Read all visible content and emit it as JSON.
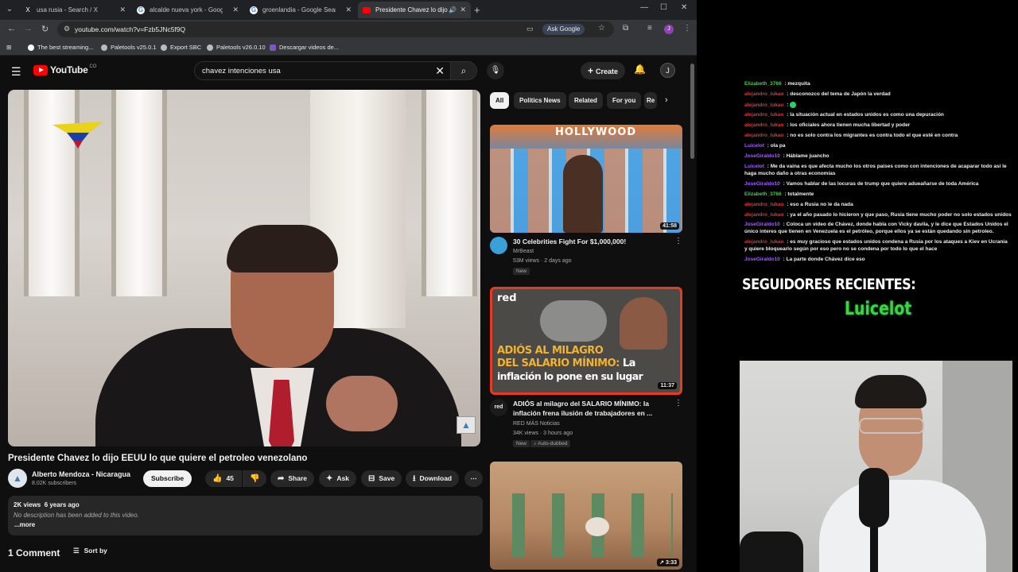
{
  "browser": {
    "tabs": [
      {
        "label": "usa rusia - Search / X",
        "favicon": "x-icon",
        "active": false
      },
      {
        "label": "alcalde nueva york - Google Search",
        "favicon": "google-icon",
        "active": false
      },
      {
        "label": "groenlandia - Google Search",
        "favicon": "google-icon",
        "active": false
      },
      {
        "label": "Presidente Chavez lo dijo EEUU",
        "favicon": "youtube-icon",
        "active": true
      }
    ],
    "url": "youtube.com/watch?v=Fzb5JNc5f9Q",
    "ask_google": "Ask Google",
    "profile_initial": "J",
    "bookmarks": [
      {
        "label": "The best streaming...",
        "color": "#ffffff"
      },
      {
        "label": "Paletools v25.0.1",
        "color": "#bbbbbb"
      },
      {
        "label": "Export SBC",
        "color": "#bbbbbb"
      },
      {
        "label": "Paletools v26.0.10",
        "color": "#bbbbbb"
      },
      {
        "label": "Descargar videos de...",
        "color": "#7e57c2"
      }
    ]
  },
  "youtube": {
    "logo": "YouTube",
    "logo_suffix": "CO",
    "search_query": "chavez intenciones usa",
    "create_label": "Create",
    "avatar_initial": "J",
    "video": {
      "title": "Presidente Chavez lo dijo EEUU lo que quiere el petroleo venezolano",
      "channel": "Alberto Mendoza - Nicaragua",
      "subscribers": "8.02K subscribers",
      "subscribe_label": "Subscribe",
      "likes": "45",
      "share_label": "Share",
      "ask_label": "Ask",
      "save_label": "Save",
      "download_label": "Download",
      "views_age": "2K views  6 years ago",
      "description": "No description has been added to this video.",
      "more_label": "...more",
      "comments_count": "1 Comment",
      "sort_label": "Sort by"
    },
    "chips": [
      "All",
      "Politics News",
      "Related",
      "For you",
      "Re"
    ],
    "recommendations": [
      {
        "title": "30 Celebrities Fight For $1,000,000!",
        "channel": "MrBeast",
        "meta": "53M views · 2 days ago",
        "badge": "New",
        "duration": "41:58",
        "thumb_text": "HOLLYWOOD"
      },
      {
        "title": "ADIÓS al milagro del SALARIO MÍNIMO: la inflación frena ilusión de trabajadores en ...",
        "channel": "RED MÁS Noticias",
        "meta": "34K views · 3 hours ago",
        "badge": "New",
        "badge2": "Auto-dubbed",
        "duration": "11:37",
        "thumb_brand": "red",
        "thumb_line1": "ADIÓS AL MILAGRO",
        "thumb_line2": "DEL SALARIO MÍNIMO:",
        "thumb_line2_accent": "La",
        "thumb_line3": "inflación lo pone en su lugar"
      },
      {
        "duration": "3:33"
      }
    ]
  },
  "stream": {
    "chat": [
      {
        "user": "Elizabeth_3766",
        "color": "#3fd43f",
        "msg": "mezquita"
      },
      {
        "user": "alejandro_lukao",
        "color": "#d23a3a",
        "msg": "desconozco del tema de Japón la verdad"
      },
      {
        "user": "alejandro_lukao",
        "color": "#d23a3a",
        "msg": ""
      },
      {
        "user": "alejandro_lukao",
        "color": "#d23a3a",
        "msg": "la situación actual en estados unidos es como una depuración"
      },
      {
        "user": "alejandro_lukao",
        "color": "#d23a3a",
        "msg": "los oficiales ahora tienen mucha libertad y poder"
      },
      {
        "user": "alejandro_lukao",
        "color": "#d23a3a",
        "msg": "no es solo contra los migrantes es contra todo el que esté en contra"
      },
      {
        "user": "Luicelot",
        "color": "#a55cff",
        "msg": "ola pa"
      },
      {
        "user": "JoseGiraldo10",
        "color": "#a55cff",
        "msg": "Háblame juancho"
      },
      {
        "user": "Luicelot",
        "color": "#a55cff",
        "msg": "Me da vaina es que afecta mucho los otros paises como con intenciones de acaparar todo así le haga mucho daño a otras economías"
      },
      {
        "user": "JoseGiraldo10",
        "color": "#a55cff",
        "msg": "Vamos hablar de las locuras de trump que quiere adueañarse de toda América"
      },
      {
        "user": "Elizabeth_3766",
        "color": "#3fd43f",
        "msg": "totalmente"
      },
      {
        "user": "alejandro_lukao",
        "color": "#d23a3a",
        "msg": "eso a Rusia no le da nada"
      },
      {
        "user": "alejandro_lukao",
        "color": "#d23a3a",
        "msg": "ya el año pasado lo hicieron y que paso, Rusia tiene mucho poder no solo estados unidos"
      },
      {
        "user": "JoseGiraldo10",
        "color": "#a55cff",
        "msg": "Coloca un video de Chávez, donde habla con Vicky davila, y le dice que Estados Unidos el único interes que tienen en Venezuela es el petróleo, porque ellos ya se están quedando sin petroleo."
      },
      {
        "user": "alejandro_lukao",
        "color": "#d23a3a",
        "msg": "es muy gracioso que estados unidos condena a Rusia por los ataques a Kiev en Ucrania y quiere bloquearlo según por eso pero no se condena por todo lo que el hace"
      },
      {
        "user": "JoseGiraldo10",
        "color": "#a55cff",
        "msg": "La parte donde Chávez dice eso"
      }
    ],
    "followers_title": "SEGUIDORES RECIENTES:",
    "follower_name": "Luicelot"
  }
}
